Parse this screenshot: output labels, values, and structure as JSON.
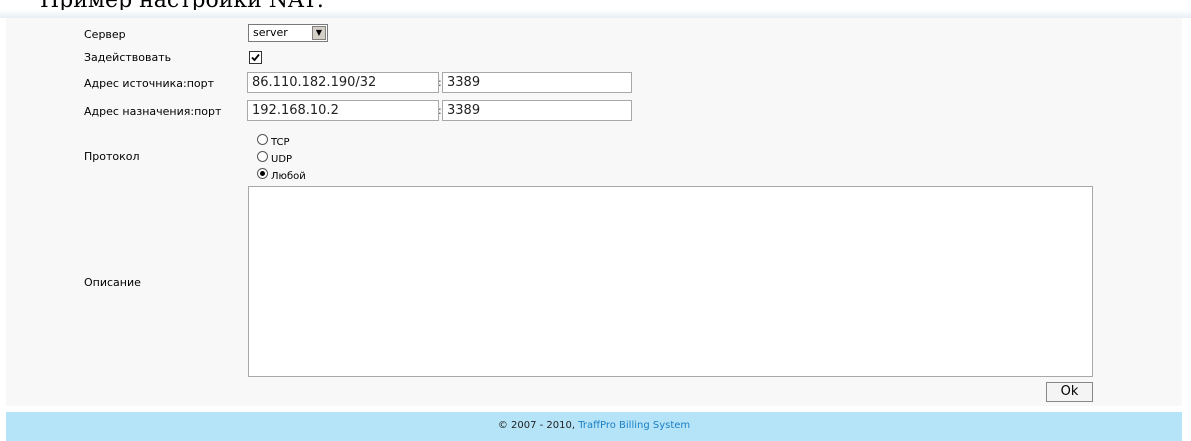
{
  "top_cut_text": "Пример настройки NAT:",
  "form": {
    "server_label": "Сервер",
    "server_value": "server",
    "enable_label": "Задействовать",
    "enable_checked": true,
    "source_label": "Адрес источника:порт",
    "source_address": "86.110.182.190/32",
    "source_port": "3389",
    "dest_label": "Адрес назначения:порт",
    "dest_address": "192.168.10.2",
    "dest_port": "3389",
    "colon": ":",
    "protocol_label": "Протокол",
    "protocol_options": [
      {
        "label": "TCP",
        "checked": false
      },
      {
        "label": "UDP",
        "checked": false
      },
      {
        "label": "Любой",
        "checked": true
      }
    ],
    "description_label": "Описание",
    "description_value": "",
    "ok_label": "Ok"
  },
  "footer": {
    "copyright": "© 2007 - 2010, ",
    "link_text": "TraffPro Billing System"
  },
  "colors": {
    "footer_bg": "#b5e3f7",
    "link": "#1a7fc4",
    "panel_bg": "#f8f8f8"
  }
}
